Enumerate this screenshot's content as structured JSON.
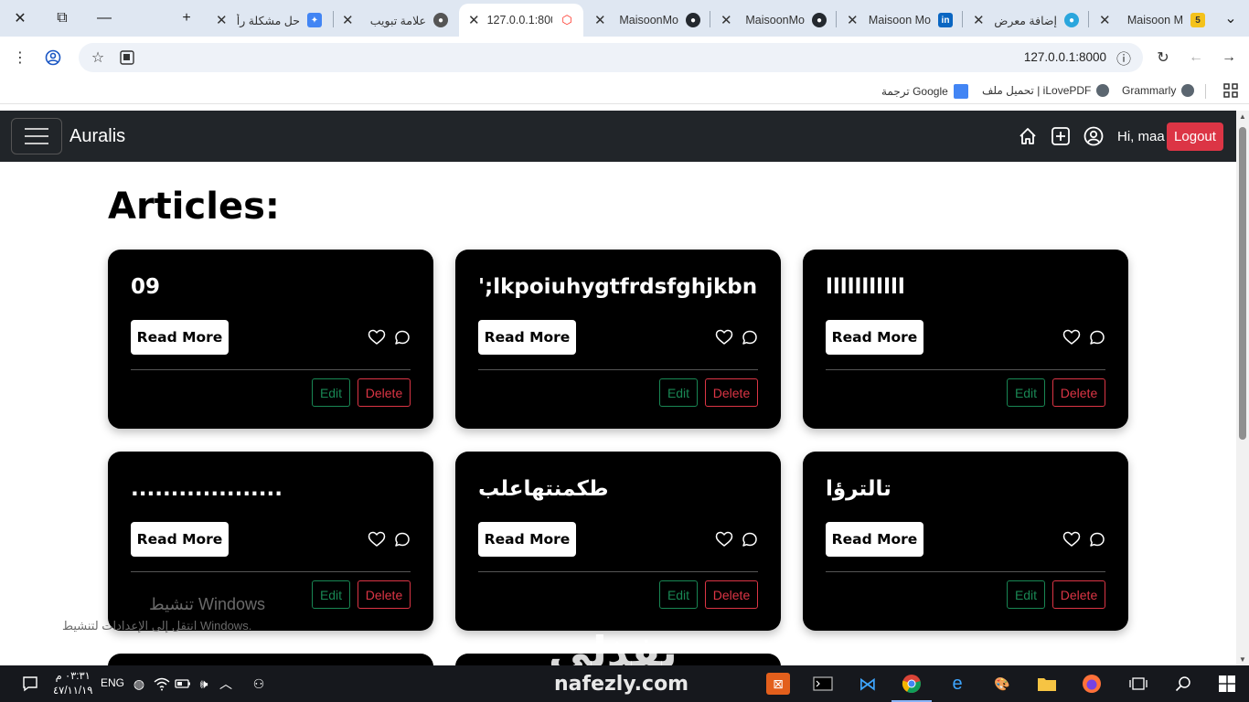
{
  "browser": {
    "tabs": [
      {
        "title": "Maisoon M",
        "icon": "5",
        "icon_color": "#f4c21b"
      },
      {
        "title": "إضافة معرض",
        "icon": "",
        "icon_color": "#2aa6dd"
      },
      {
        "title": "Maisoon Mo",
        "icon": "in",
        "icon_color": "#0a66c2"
      },
      {
        "title": "MaisoonMo",
        "icon": "",
        "icon_color": "#24292f"
      },
      {
        "title": "MaisoonMo",
        "icon": "",
        "icon_color": "#24292f"
      },
      {
        "title": "127.0.0.1:800",
        "icon": "",
        "icon_color": "#ff2d20",
        "active": true
      },
      {
        "title": "علامة تبويب",
        "icon": "",
        "icon_color": "#555555"
      },
      {
        "title": "حل مشكلة رأ",
        "icon": "",
        "icon_color": "#4285f4"
      }
    ],
    "url": "127.0.0.1:8000",
    "bookmarks": [
      {
        "label": "Grammarly"
      },
      {
        "label": "تحميل ملف | iLovePDF"
      },
      {
        "label": "ترجمة Google"
      }
    ]
  },
  "navbar": {
    "brand": "Auralis",
    "greeting": "Hi, maa",
    "logout_label": "Logout"
  },
  "page": {
    "heading": "Articles:",
    "read_more_label": "Read More",
    "edit_label": "Edit",
    "delete_label": "Delete",
    "articles": [
      {
        "title": "09"
      },
      {
        "title": "';lkpoiuhygtfrdsfghjkbnlm"
      },
      {
        "title": "lllllllllll"
      },
      {
        "title": "..................."
      },
      {
        "title": "طكمنتهاعلب"
      },
      {
        "title": "تالترؤا"
      }
    ]
  },
  "overlay": {
    "activation_title": "تنشيط Windows",
    "activation_subtitle": "انتقل إلى الإعدادات لتنشيط Windows.",
    "watermark_ar": "نفذلي",
    "watermark_url": "nafezly.com"
  },
  "taskbar": {
    "time": "٠٣:٣١ م",
    "date": "٤٧/١١/١٩",
    "language": "ENG"
  },
  "colors": {
    "navbar_bg": "#212529",
    "card_bg": "#000000",
    "logout_bg": "#dc3545",
    "edit_border": "#198754",
    "delete_border": "#dc3545"
  }
}
